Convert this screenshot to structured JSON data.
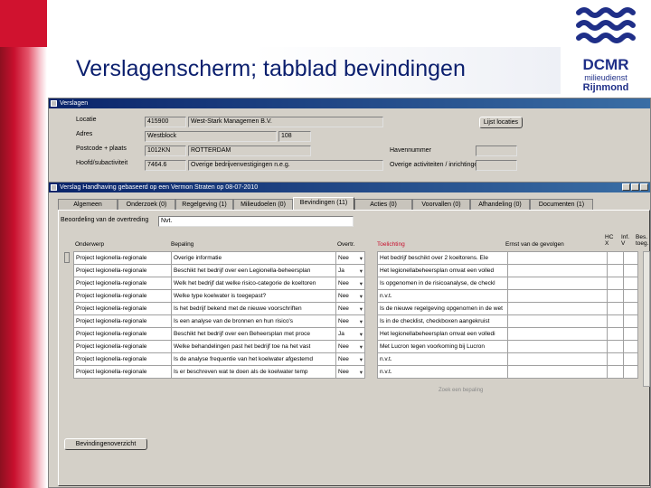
{
  "slide": {
    "title": "Verslagenscherm; tabblad bevindingen",
    "logo": {
      "line1": "DCMR",
      "line2": "milieudienst",
      "line3": "Rijnmond"
    }
  },
  "outer_window": {
    "title": "Verslagen",
    "fields": {
      "locatie_label": "Locatie",
      "locatie_code": "415900",
      "locatie_name": "West-Stark Managemen B.V.",
      "adres_label": "Adres",
      "adres_street": "Westblock",
      "adres_number": "108",
      "postcode_label": "Postcode + plaats",
      "postcode": "1012KN",
      "plaats": "ROTTERDAM",
      "havennummer_label": "Havennummer",
      "havennummer": "",
      "hoofdsubact_label": "Hoofd/subactiviteit",
      "hoofdsubact_code": "7464.6",
      "hoofdsubact_desc": "Overige bedrijvenvestigingen n.e.g.",
      "overige_label": "Overige activiteiten / inrichtingen",
      "overige_value": "",
      "lijst_button": "Lijst locaties"
    }
  },
  "inner_window": {
    "title": "Verslag Handhaving gebaseerd op een Vermon Straten op 08-07-2010",
    "tabs": [
      {
        "label": "Algemeen"
      },
      {
        "label": "Onderzoek (0)"
      },
      {
        "label": "Regelgeving (1)"
      },
      {
        "label": "Milieudoelen (0)"
      },
      {
        "label": "Bevindingen (11)",
        "active": true
      },
      {
        "label": "Acties (0)"
      },
      {
        "label": "Voorvallen (0)"
      },
      {
        "label": "Afhandeling (0)"
      },
      {
        "label": "Documenten (1)"
      }
    ],
    "beoordeling_label": "Beoordeling van de overtreding",
    "beoordeling_value": "Nvt.",
    "columns": {
      "onderwerp": "Onderwerp",
      "bepaling": "Bepaling",
      "overtr": "Overtr.",
      "toelichting": "Toelichting",
      "gevolgen": "Ernst van de gevolgen",
      "hc": "HC X",
      "inf": "Inf. V",
      "bes": "Bes. toeg."
    },
    "rows": [
      {
        "onderwerp": "Project legionella-regionale",
        "bepaling": "Overige informatie",
        "overtr": "Nee",
        "toelichting": "Het bedrijf beschikt over 2 koeltorens. Ele"
      },
      {
        "onderwerp": "Project legionella-regionale",
        "bepaling": "Beschikt het bedrijf over een Legionella-beheersplan",
        "overtr": "Ja",
        "toelichting": "Het legionellabeheersplan omvat een volled"
      },
      {
        "onderwerp": "Project legionella-regionale",
        "bepaling": "Welk het bedrijf dat welke risico-categorie de koeltoren",
        "overtr": "Nee",
        "toelichting": "Is opgenomen in de risicoanalyse, de checkl"
      },
      {
        "onderwerp": "Project legionella-regionale",
        "bepaling": "Welke type koelwater is toegepast?",
        "overtr": "Nee",
        "toelichting": "n.v.t."
      },
      {
        "onderwerp": "Project legionella-regionale",
        "bepaling": "Is het bedrijf bekend met de nieuwe voorschriften",
        "overtr": "Nee",
        "toelichting": "Is de nieuwe regelgeving opgenomen in de wet"
      },
      {
        "onderwerp": "Project legionella-regionale",
        "bepaling": "Is een analyse van de bronnen en hun risico's",
        "overtr": "Nee",
        "toelichting": "Is in de checklist, checkboxen aangekruist"
      },
      {
        "onderwerp": "Project legionella-regionale",
        "bepaling": "Beschikt het bedrijf over een Beheersplan met proce",
        "overtr": "Ja",
        "toelichting": "Het legionellabeheersplan omvat een volledi"
      },
      {
        "onderwerp": "Project legionella-regionale",
        "bepaling": "Welke behandelingen past het bedrijf toe na het vast",
        "overtr": "Nee",
        "toelichting": "Met Lucron tegen voorkoming bij Lucron"
      },
      {
        "onderwerp": "Project legionella-regionale",
        "bepaling": "Is de analyse frequentie van het koelwater afgestemd",
        "overtr": "Nee",
        "toelichting": "n.v.t."
      },
      {
        "onderwerp": "Project legionella-regionale",
        "bepaling": "Is er beschreven wat te doen als de koelwater temp",
        "overtr": "Nee",
        "toelichting": "n.v.t."
      }
    ],
    "footer_button": "Bevindingenoverzicht",
    "bottom_note": "Zoek een bepaling"
  }
}
